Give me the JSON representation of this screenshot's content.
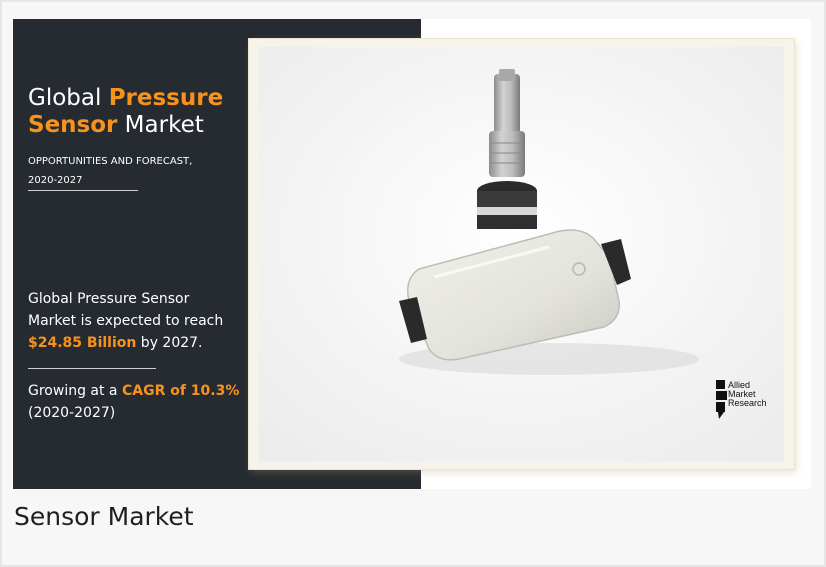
{
  "banner": {
    "title_part1": "Global ",
    "title_highlight1": "Pressure",
    "title_highlight2": "Sensor",
    "title_part2": " Market",
    "subtitle_line1": "OPPORTUNITIES AND FORECAST,",
    "subtitle_line2": "2020-2027",
    "stat_line1": "Global Pressure Sensor",
    "stat_line2": "Market is expected to reach",
    "stat_value": "$24.85 Billion",
    "stat_suffix": " by 2027.",
    "growth_prefix": "Growing at a ",
    "growth_value": "CAGR of 10.3%",
    "growth_period": "(2020-2027)",
    "accent_color": "#f7931d",
    "panel_color": "#252b31"
  },
  "logo": {
    "line1": "Allied",
    "line2": "Market",
    "line3": "Research"
  },
  "caption": {
    "text": "Sensor Market"
  }
}
